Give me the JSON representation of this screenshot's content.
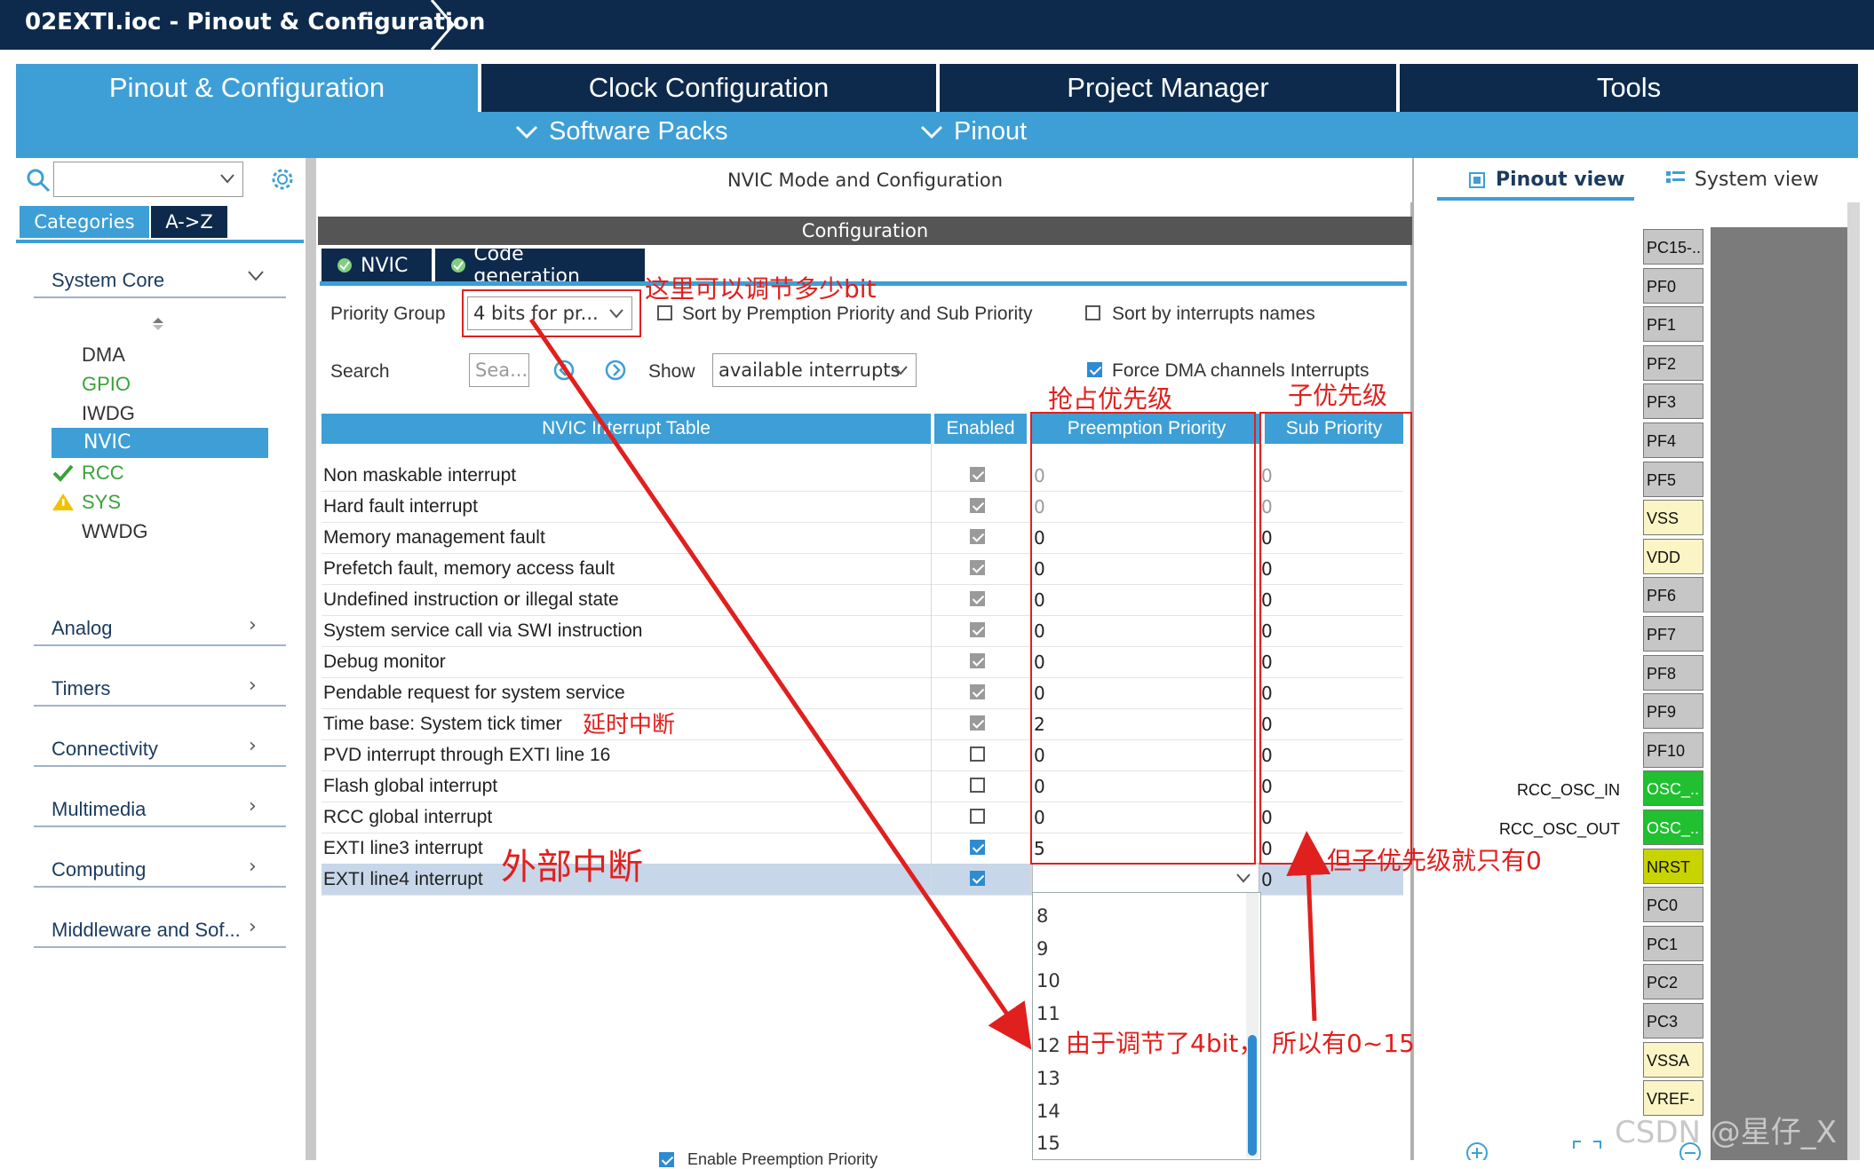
{
  "window": {
    "title": "02EXTI.ioc - Pinout & Configuration"
  },
  "main_tabs": [
    {
      "label": "Pinout & Configuration",
      "active": true
    },
    {
      "label": "Clock Configuration",
      "active": false
    },
    {
      "label": "Project Manager",
      "active": false
    },
    {
      "label": "Tools",
      "active": false
    }
  ],
  "sub_menu": {
    "software_packs": "Software Packs",
    "pinout": "Pinout"
  },
  "left": {
    "search_placeholder": "",
    "tabs": {
      "categories": "Categories",
      "az": "A->Z"
    },
    "categories": [
      "System Core",
      "Analog",
      "Timers",
      "Connectivity",
      "Multimedia",
      "Computing",
      "Middleware and Sof..."
    ],
    "system_core_items": [
      {
        "label": "DMA",
        "color": "#333333",
        "status": ""
      },
      {
        "label": "GPIO",
        "color": "#3aa23a",
        "status": ""
      },
      {
        "label": "IWDG",
        "color": "#333333",
        "status": ""
      },
      {
        "label": "NVIC",
        "color": "#ffffff",
        "status": "selected"
      },
      {
        "label": "RCC",
        "color": "#3aa23a",
        "status": "check"
      },
      {
        "label": "SYS",
        "color": "#3aa23a",
        "status": "warning"
      },
      {
        "label": "WWDG",
        "color": "#333333",
        "status": ""
      }
    ]
  },
  "center": {
    "title": "NVIC Mode and Configuration",
    "config_label": "Configuration",
    "tabs": {
      "nvic": "NVIC",
      "code_generation": "Code generation"
    },
    "priority_group_label": "Priority Group",
    "priority_group_value": "4 bits for pr...",
    "sort_premption_label": "Sort by Premption Priority and Sub Priority",
    "sort_names_label": "Sort by interrupts names",
    "search_label": "Search",
    "search_placeholder": "Sea...",
    "show_label": "Show",
    "show_value": "available interrupts",
    "force_dma_label": "Force DMA channels Interrupts",
    "table_headers": {
      "name": "NVIC Interrupt Table",
      "enabled": "Enabled",
      "preemption": "Preemption Priority",
      "sub": "Sub Priority"
    },
    "rows": [
      {
        "name": "Non maskable interrupt",
        "enabled": "locked",
        "pre": "0",
        "sub": "0",
        "dim": true
      },
      {
        "name": "Hard fault interrupt",
        "enabled": "locked",
        "pre": "0",
        "sub": "0",
        "dim": true
      },
      {
        "name": "Memory management fault",
        "enabled": "locked",
        "pre": "0",
        "sub": "0",
        "dim": false
      },
      {
        "name": "Prefetch fault, memory access fault",
        "enabled": "locked",
        "pre": "0",
        "sub": "0",
        "dim": false
      },
      {
        "name": "Undefined instruction or illegal state",
        "enabled": "locked",
        "pre": "0",
        "sub": "0",
        "dim": false
      },
      {
        "name": "System service call via SWI instruction",
        "enabled": "locked",
        "pre": "0",
        "sub": "0",
        "dim": false
      },
      {
        "name": "Debug monitor",
        "enabled": "locked",
        "pre": "0",
        "sub": "0",
        "dim": false
      },
      {
        "name": "Pendable request for system service",
        "enabled": "locked",
        "pre": "0",
        "sub": "0",
        "dim": false
      },
      {
        "name": "Time base: System tick timer",
        "enabled": "locked",
        "pre": "2",
        "sub": "0",
        "dim": false
      },
      {
        "name": "PVD interrupt through EXTI line 16",
        "enabled": "off",
        "pre": "0",
        "sub": "0",
        "dim": false
      },
      {
        "name": "Flash global interrupt",
        "enabled": "off",
        "pre": "0",
        "sub": "0",
        "dim": false
      },
      {
        "name": "RCC global interrupt",
        "enabled": "off",
        "pre": "0",
        "sub": "0",
        "dim": false
      },
      {
        "name": "EXTI line3 interrupt",
        "enabled": "on",
        "pre": "5",
        "sub": "0",
        "dim": false
      },
      {
        "name": "EXTI line4 interrupt",
        "enabled": "on",
        "pre": "",
        "sub": "0",
        "dim": false
      }
    ],
    "dropdown_options": [
      "8",
      "9",
      "10",
      "11",
      "12",
      "13",
      "14",
      "15"
    ],
    "bottom_partial": "Enable Preemption Priority"
  },
  "right": {
    "pinout_view": "Pinout view",
    "system_view": "System view",
    "pins": [
      {
        "label": "PC15-..",
        "style": "grey"
      },
      {
        "label": "PF0",
        "style": "grey"
      },
      {
        "label": "PF1",
        "style": "grey"
      },
      {
        "label": "PF2",
        "style": "grey"
      },
      {
        "label": "PF3",
        "style": "grey"
      },
      {
        "label": "PF4",
        "style": "grey"
      },
      {
        "label": "PF5",
        "style": "grey"
      },
      {
        "label": "VSS",
        "style": "yellow"
      },
      {
        "label": "VDD",
        "style": "yellow"
      },
      {
        "label": "PF6",
        "style": "grey"
      },
      {
        "label": "PF7",
        "style": "grey"
      },
      {
        "label": "PF8",
        "style": "grey"
      },
      {
        "label": "PF9",
        "style": "grey"
      },
      {
        "label": "PF10",
        "style": "grey"
      },
      {
        "label": "OSC_..",
        "style": "green"
      },
      {
        "label": "OSC_..",
        "style": "green"
      },
      {
        "label": "NRST",
        "style": "lime"
      },
      {
        "label": "PC0",
        "style": "grey"
      },
      {
        "label": "PC1",
        "style": "grey"
      },
      {
        "label": "PC2",
        "style": "grey"
      },
      {
        "label": "PC3",
        "style": "grey"
      },
      {
        "label": "VSSA",
        "style": "yellow"
      },
      {
        "label": "VREF-",
        "style": "yellow"
      }
    ],
    "pin_signals": {
      "osc_in": "RCC_OSC_IN",
      "osc_out": "RCC_OSC_OUT"
    }
  },
  "annotations": {
    "priority_bits": "这里可以调节多少bit",
    "preemption": "抢占优先级",
    "sub": "子优先级",
    "systick": "延时中断",
    "exti": "外部中断",
    "sub_only_zero": "但子优先级就只有0",
    "four_bit": "由于调节了4bit，",
    "range": "所以有0~15"
  },
  "watermark": "CSDN @星仔_X"
}
